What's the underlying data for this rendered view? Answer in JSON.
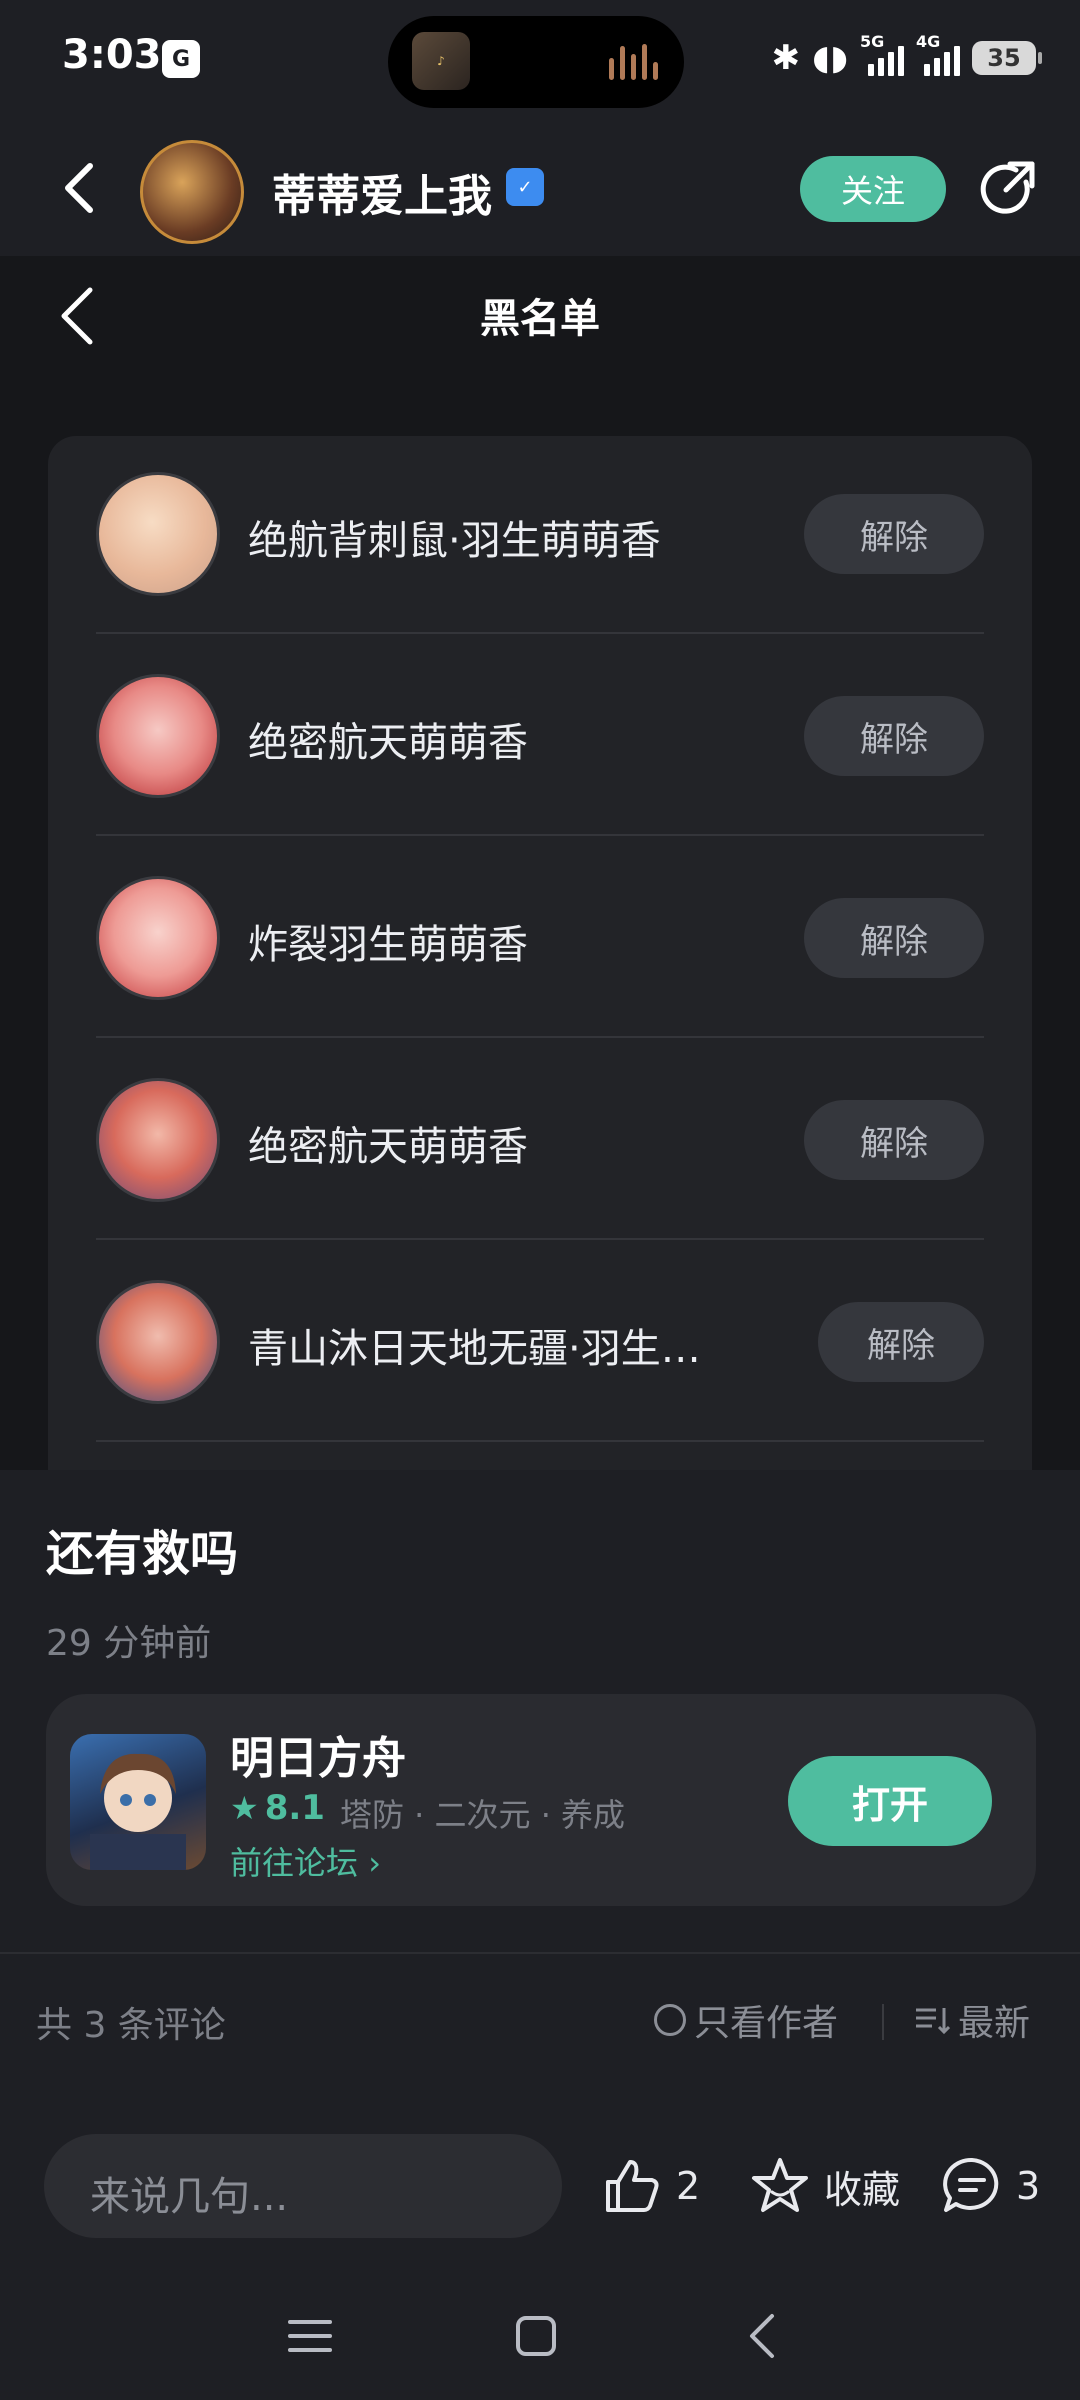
{
  "status_bar": {
    "time": "3:03",
    "app_icon_text": "G",
    "network_1": "5G",
    "network_2": "4G",
    "battery": "35"
  },
  "header": {
    "title": "蒂蒂爱上我",
    "follow_label": "关注"
  },
  "blacklist": {
    "title": "黑名单",
    "remove_label": "解除",
    "items": [
      {
        "name": "绝航背刺鼠·羽生萌萌香"
      },
      {
        "name": "绝密航天萌萌香"
      },
      {
        "name": "炸裂羽生萌萌香"
      },
      {
        "name": "绝密航天萌萌香"
      },
      {
        "name": "青山沐日天地无疆·羽生…"
      }
    ]
  },
  "post": {
    "title": "还有救吗",
    "time": "29 分钟前"
  },
  "game_card": {
    "name": "明日方舟",
    "rating": "8.1",
    "tags": "塔防 · 二次元 · 养成",
    "forum_link": "前往论坛",
    "open_label": "打开"
  },
  "comments": {
    "count_label": "共 3 条评论",
    "author_only_label": "只看作者",
    "sort_label": "最新"
  },
  "action_bar": {
    "input_placeholder": "来说几句...",
    "like_count": "2",
    "favorite_label": "收藏",
    "comment_count": "3"
  },
  "colors": {
    "accent": "#4fbd9f",
    "background": "#1e1f24",
    "card": "#222327"
  }
}
